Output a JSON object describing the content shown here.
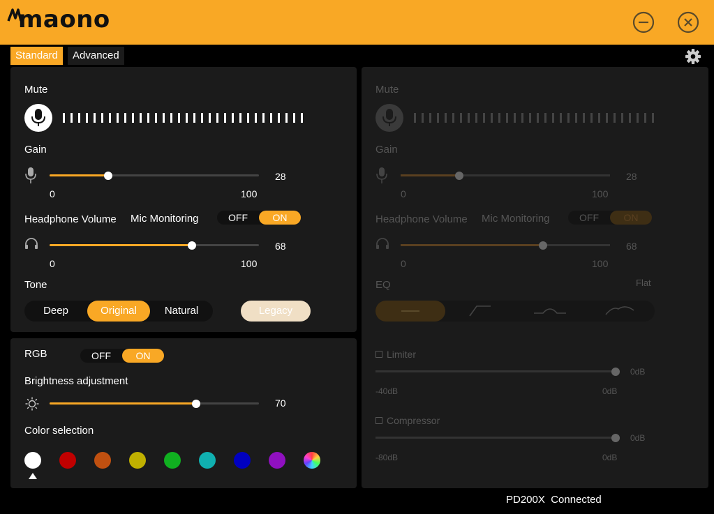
{
  "brand": {
    "logo_text": "maono"
  },
  "titlebar": {
    "minimize_icon": "minimize-circle-icon",
    "close_icon": "close-circle-icon"
  },
  "tabs": [
    {
      "label": "Standard",
      "active": true
    },
    {
      "label": "Advanced",
      "active": false
    }
  ],
  "left_panel": {
    "mute_label": "Mute",
    "gain_label": "Gain",
    "gain": {
      "value": "28",
      "fraction": 0.28,
      "min": "0",
      "max": "100"
    },
    "headphone_label": "Headphone Volume",
    "monitoring_label": "Mic Monitoring",
    "monitoring": {
      "off": "OFF",
      "on": "ON",
      "state": "ON"
    },
    "headphone": {
      "value": "68",
      "fraction": 0.68,
      "min": "0",
      "max": "100"
    },
    "tone_label": "Tone",
    "tone_options": [
      "Deep",
      "Original",
      "Natural"
    ],
    "tone_selected": "Original",
    "legacy_label": "Legacy"
  },
  "rgb_panel": {
    "rgb_label": "RGB",
    "rgb_toggle": {
      "off": "OFF",
      "on": "ON",
      "state": "ON"
    },
    "brightness_label": "Brightness adjustment",
    "brightness": {
      "value": "70",
      "fraction": 0.7
    },
    "color_label": "Color selection",
    "colors": [
      "#ffffff",
      "#c00000",
      "#c05010",
      "#c0b000",
      "#10b020",
      "#10b0b0",
      "#0000c0",
      "#9010c0",
      "rainbow"
    ],
    "selected_color_index": 0
  },
  "right_panel": {
    "mute_label": "Mute",
    "gain_label": "Gain",
    "gain": {
      "value": "28",
      "fraction": 0.28,
      "min": "0",
      "max": "100"
    },
    "headphone_label": "Headphone Volume",
    "monitoring_label": "Mic Monitoring",
    "monitoring": {
      "off": "OFF",
      "on": "ON"
    },
    "headphone": {
      "value": "68",
      "fraction": 0.68,
      "min": "0",
      "max": "100"
    },
    "eq_label": "EQ",
    "eq_preset": "Flat",
    "limiter_label": "Limiter",
    "limiter": {
      "value": "0dB",
      "min": "-40dB",
      "max": "0dB"
    },
    "compressor_label": "Compressor",
    "compressor": {
      "value": "0dB",
      "min": "-80dB",
      "max": "0dB"
    }
  },
  "status": {
    "device": "PD200X",
    "state": "Connected"
  },
  "colors": {
    "accent": "#f9a825",
    "panel": "#1b1b1b",
    "background": "#000000"
  }
}
